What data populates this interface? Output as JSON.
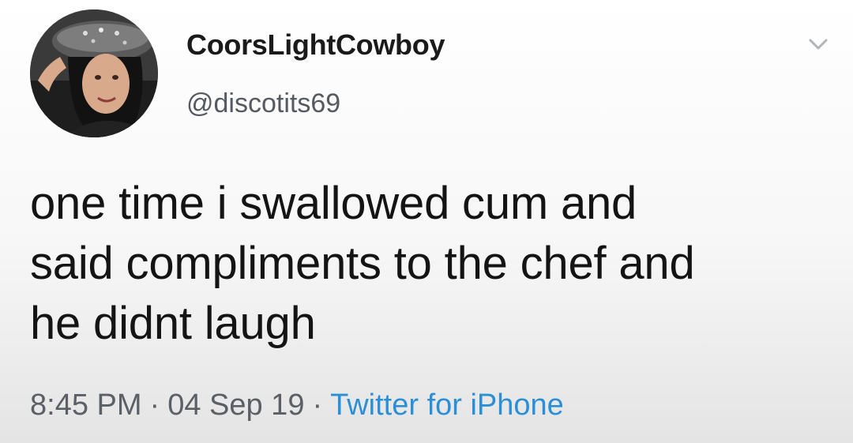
{
  "tweet": {
    "display_name": "CoorsLightCowboy",
    "handle": "@discotits69",
    "text_lines": [
      "one time i swallowed cum and",
      "said compliments to the chef and",
      "he didnt laugh"
    ],
    "time": "8:45 PM",
    "separator": "·",
    "date": "04 Sep 19",
    "source": "Twitter for iPhone"
  },
  "icons": {
    "menu": "chevron-down-icon",
    "avatar": "profile-photo"
  },
  "colors": {
    "source_link": "#2a8fd6",
    "handle": "#555a60",
    "text": "#141414"
  }
}
